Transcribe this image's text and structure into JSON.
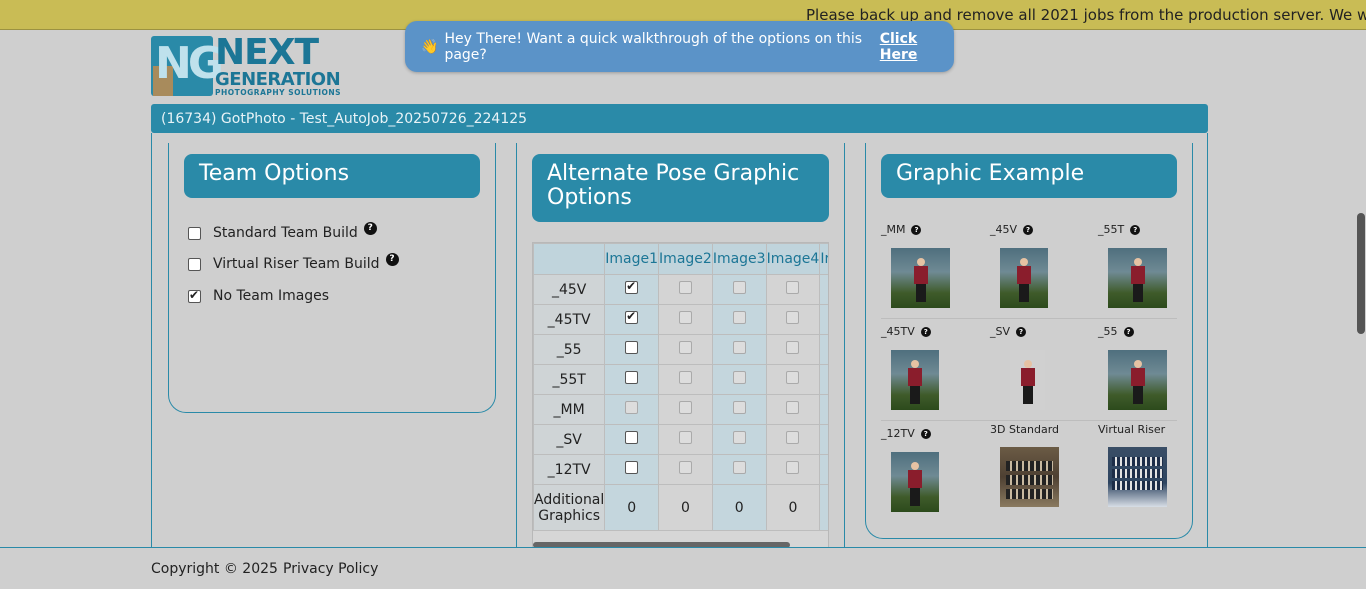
{
  "banner": {
    "text": "Please back up and remove all 2021 jobs from the production server. We will"
  },
  "walkthrough": {
    "emoji": "👋",
    "text": "Hey There! Want a quick walkthrough of the options on this page?",
    "link": "Click Here"
  },
  "logo": {
    "mark": "NG",
    "line1": "NEXT",
    "line2": "GENERATION",
    "line3": "PHOTOGRAPHY SOLUTIONS"
  },
  "job": {
    "title": "(16734) GotPhoto - Test_AutoJob_20250726_224125"
  },
  "team_options": {
    "title": "Team Options",
    "items": [
      {
        "label": "Standard Team Build",
        "checked": false
      },
      {
        "label": "Virtual Riser Team Build",
        "checked": false
      },
      {
        "label": "No Team Images",
        "checked": true
      }
    ]
  },
  "alternate_pose": {
    "title_line1": "Alternate Pose Graphic",
    "title_line2": "Options",
    "columns": [
      "Image1",
      "Image2",
      "Image3",
      "Image4",
      "Ir"
    ],
    "rows": [
      {
        "label": "_45V",
        "image1": true
      },
      {
        "label": "_45TV",
        "image1": true
      },
      {
        "label": "_55",
        "image1": false
      },
      {
        "label": "_55T",
        "image1": false
      },
      {
        "label": "_MM",
        "image1": false
      },
      {
        "label": "_SV",
        "image1": false
      },
      {
        "label": "_12TV",
        "image1": false
      }
    ],
    "additional_label_line1": "Additional",
    "additional_label_line2": "Graphics",
    "additional_values": [
      "0",
      "0",
      "0",
      "0"
    ]
  },
  "graphic_example": {
    "title": "Graphic Example",
    "items": [
      {
        "label": "_MM"
      },
      {
        "label": "_45V"
      },
      {
        "label": "_55T"
      },
      {
        "label": "_45TV"
      },
      {
        "label": "_SV"
      },
      {
        "label": "_55"
      },
      {
        "label": "_12TV"
      },
      {
        "label": "3D Standard"
      },
      {
        "label": "Virtual Riser"
      }
    ]
  },
  "footer": {
    "copyright": "Copyright © 2025",
    "privacy": "Privacy Policy"
  },
  "help_glyph": "?"
}
